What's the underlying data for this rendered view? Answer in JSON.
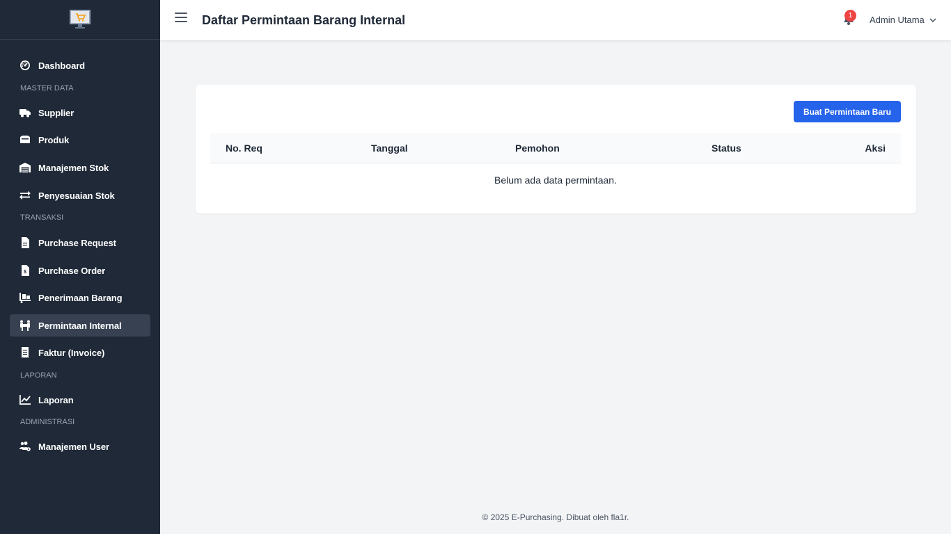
{
  "app": {
    "logo_icon": "shopping-cart-monitor-icon",
    "colors": {
      "sidebar": "#1f2937",
      "active": "#374151",
      "primary": "#2563eb",
      "badge": "#ef4444"
    }
  },
  "sidebar": {
    "dashboard": {
      "label": "Dashboard",
      "icon": "gauge-icon"
    },
    "sections": {
      "master_data": "MASTER DATA",
      "transaksi": "TRANSAKSI",
      "laporan": "LAPORAN",
      "administrasi": "ADMINISTRASI"
    },
    "items": [
      {
        "label": "Supplier",
        "icon": "truck-icon"
      },
      {
        "label": "Produk",
        "icon": "box-icon"
      },
      {
        "label": "Manajemen Stok",
        "icon": "warehouse-icon"
      },
      {
        "label": "Penyesuaian Stok",
        "icon": "exchange-icon"
      },
      {
        "label": "Purchase Request",
        "icon": "file-icon"
      },
      {
        "label": "Purchase Order",
        "icon": "file-invoice-icon"
      },
      {
        "label": "Penerimaan Barang",
        "icon": "dolly-icon"
      },
      {
        "label": "Permintaan Internal",
        "icon": "people-carry-icon",
        "active": true
      },
      {
        "label": "Faktur (Invoice)",
        "icon": "receipt-icon"
      },
      {
        "label": "Laporan",
        "icon": "chart-line-icon"
      },
      {
        "label": "Manajemen User",
        "icon": "users-cog-icon"
      }
    ]
  },
  "header": {
    "title": "Daftar Permintaan Barang Internal",
    "notification_count": "1",
    "user_name": "Admin Utama"
  },
  "main": {
    "new_button": "Buat Permintaan Baru",
    "columns": [
      "No. Req",
      "Tanggal",
      "Pemohon",
      "Status",
      "Aksi"
    ],
    "empty_message": "Belum ada data permintaan."
  },
  "footer": {
    "text": "© 2025 E-Purchasing. Dibuat oleh fla1r."
  }
}
